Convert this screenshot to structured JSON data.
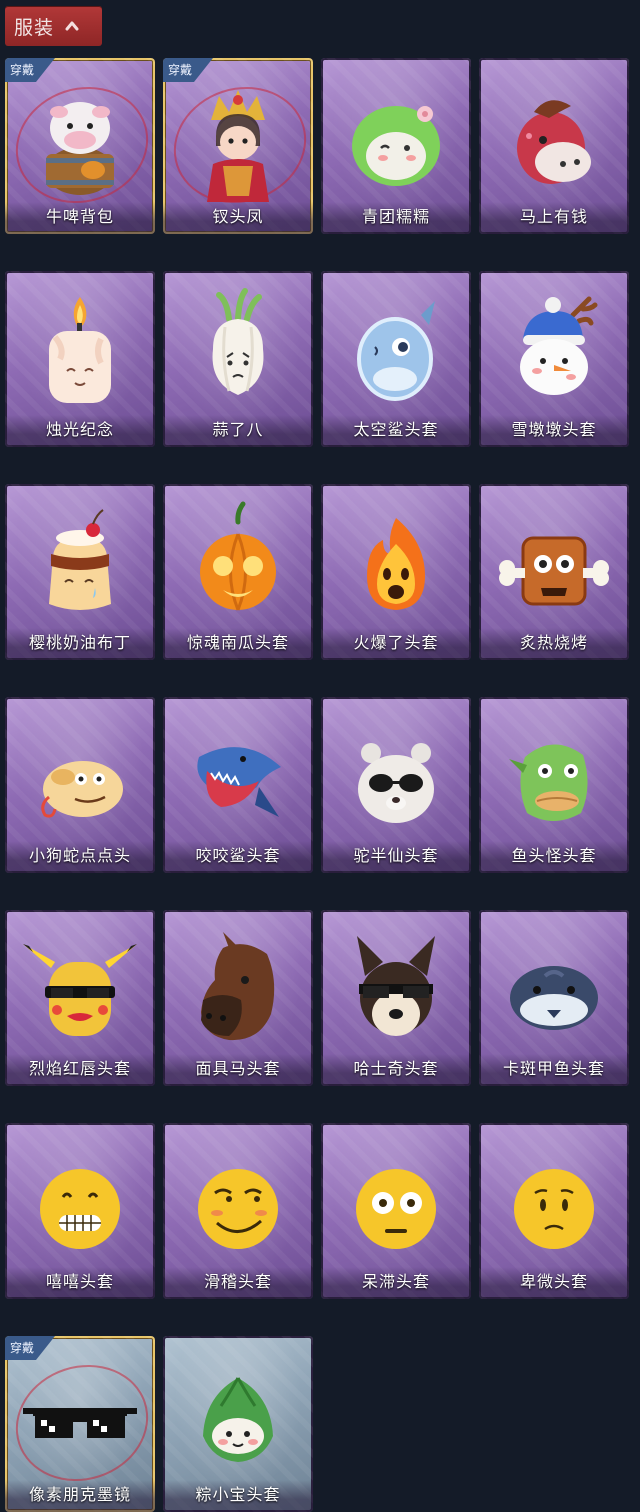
{
  "header": {
    "title": "服装"
  },
  "worn_badge": "穿戴",
  "items": [
    {
      "label": "牛啤背包",
      "worn": true,
      "theme": "purple",
      "art": "cow-barrel"
    },
    {
      "label": "钗头凤",
      "worn": true,
      "theme": "purple",
      "art": "phoenix-crown-doll"
    },
    {
      "label": "青团糯糯",
      "worn": false,
      "theme": "purple",
      "art": "green-dumpling"
    },
    {
      "label": "马上有钱",
      "worn": false,
      "theme": "purple",
      "art": "red-horse"
    },
    {
      "label": "烛光纪念",
      "worn": false,
      "theme": "purple",
      "art": "candle"
    },
    {
      "label": "蒜了八",
      "worn": false,
      "theme": "purple",
      "art": "garlic"
    },
    {
      "label": "太空鲨头套",
      "worn": false,
      "theme": "purple",
      "art": "space-shark"
    },
    {
      "label": "雪墩墩头套",
      "worn": false,
      "theme": "purple",
      "art": "snowman-reindeer"
    },
    {
      "label": "樱桃奶油布丁",
      "worn": false,
      "theme": "purple",
      "art": "cherry-pudding"
    },
    {
      "label": "惊魂南瓜头套",
      "worn": false,
      "theme": "purple",
      "art": "pumpkin"
    },
    {
      "label": "火爆了头套",
      "worn": false,
      "theme": "purple",
      "art": "fireball"
    },
    {
      "label": "炙热烧烤",
      "worn": false,
      "theme": "purple",
      "art": "bbq-meat"
    },
    {
      "label": "小狗蛇点点头",
      "worn": false,
      "theme": "purple",
      "art": "dog-snake"
    },
    {
      "label": "咬咬鲨头套",
      "worn": false,
      "theme": "purple",
      "art": "biting-shark"
    },
    {
      "label": "驼半仙头套",
      "worn": false,
      "theme": "purple",
      "art": "bear-sunglasses"
    },
    {
      "label": "鱼头怪头套",
      "worn": false,
      "theme": "purple",
      "art": "fish-head"
    },
    {
      "label": "烈焰红唇头套",
      "worn": false,
      "theme": "purple",
      "art": "yellow-pika-mask"
    },
    {
      "label": "面具马头套",
      "worn": false,
      "theme": "purple",
      "art": "horse-mask"
    },
    {
      "label": "哈士奇头套",
      "worn": false,
      "theme": "purple",
      "art": "husky-sunglasses"
    },
    {
      "label": "卡斑甲鱼头套",
      "worn": false,
      "theme": "purple",
      "art": "whale-fish"
    },
    {
      "label": "嘻嘻头套",
      "worn": false,
      "theme": "purple",
      "art": "emoji-grin"
    },
    {
      "label": "滑稽头套",
      "worn": false,
      "theme": "purple",
      "art": "emoji-smirk"
    },
    {
      "label": "呆滞头套",
      "worn": false,
      "theme": "purple",
      "art": "emoji-stare"
    },
    {
      "label": "卑微头套",
      "worn": false,
      "theme": "purple",
      "art": "emoji-humble"
    },
    {
      "label": "像素朋克墨镜",
      "worn": true,
      "theme": "gray",
      "art": "pixel-sunglasses"
    },
    {
      "label": "粽小宝头套",
      "worn": false,
      "theme": "gray",
      "art": "zongzi"
    }
  ]
}
